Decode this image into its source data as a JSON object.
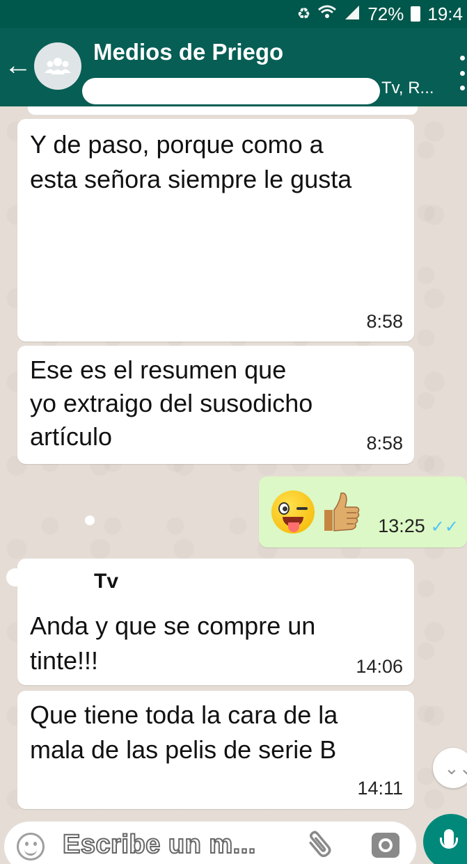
{
  "status_bar": {
    "battery": "72%",
    "time": "19:4",
    "icons": [
      "recycle-icon",
      "wifi-icon",
      "signal-icon",
      "battery-icon"
    ]
  },
  "header": {
    "back_icon": "arrow-left-icon",
    "avatar_icon": "group-icon",
    "title": "Medios de Priego",
    "subtitle_visible": "Tv, R...",
    "menu_icon": "more-vert-icon"
  },
  "messages": [
    {
      "direction": "incoming",
      "sender": "",
      "lines": [
        "Y de paso, porque como a",
        "esta señora siempre le gusta"
      ],
      "time": "8:58"
    },
    {
      "direction": "incoming",
      "sender": "",
      "lines": [
        "Ese es el resumen que",
        "yo extraigo del susodicho",
        "artículo"
      ],
      "time": "8:58"
    },
    {
      "direction": "outgoing",
      "emojis": [
        "winking-face-with-tongue-emoji",
        "thumbs-up-emoji"
      ],
      "time": "13:25",
      "status_icon": "double-check-icon",
      "status": "✓✓"
    },
    {
      "direction": "incoming",
      "sender": "Tv",
      "lines": [
        "Anda y que se compre un",
        "tinte!!!"
      ],
      "time": "14:06"
    },
    {
      "direction": "incoming",
      "sender": "",
      "lines": [
        "Que tiene toda la cara de la",
        "mala de las pelis de serie B"
      ],
      "time": "14:11"
    }
  ],
  "scroll_down": {
    "icon": "double-chevron-down-icon",
    "glyph": "⌄⌄"
  },
  "composer": {
    "emoji_icon": "emoji-icon",
    "placeholder": "Escribe un m...",
    "attach_icon": "paperclip-icon",
    "camera_icon": "camera-icon",
    "mic_icon": "mic-icon"
  },
  "colors": {
    "status_bar": "#00574b",
    "app_bar": "#075e54",
    "chat_bg": "#e5ddd5",
    "outgoing_bubble": "#dcf8c6",
    "read_ticks": "#4fc3f7",
    "mic_button": "#00897b"
  }
}
